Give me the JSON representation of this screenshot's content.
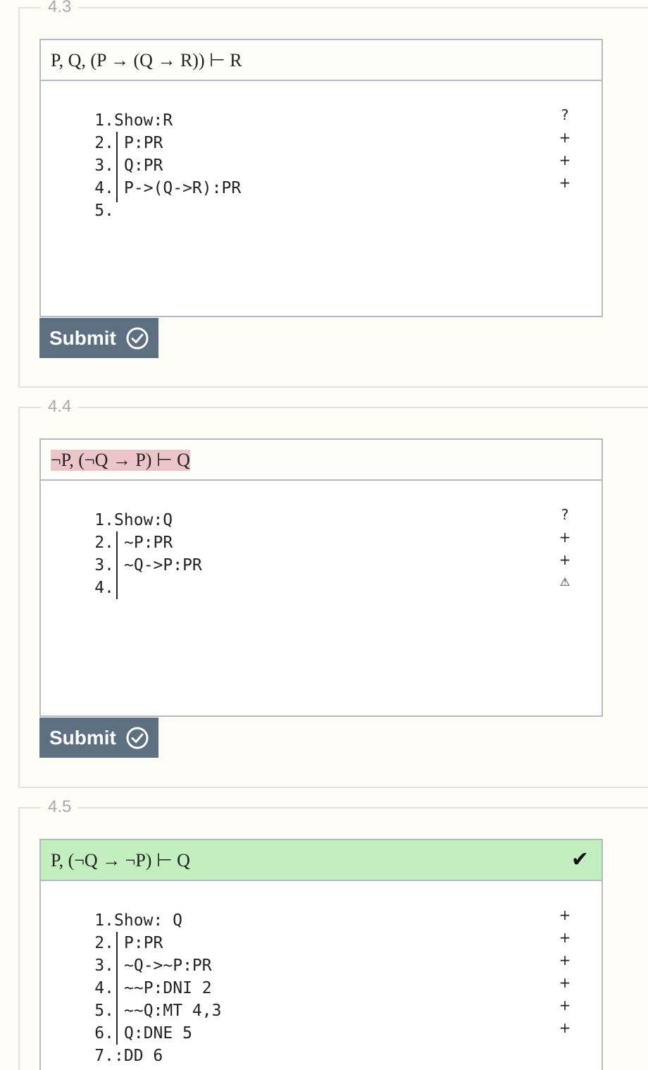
{
  "problems": [
    {
      "number": "4.3",
      "sequent": "P, Q, (P → (Q → R)) ⊢ R",
      "lines": [
        {
          "n": "1.",
          "text": "Show:R"
        },
        {
          "n": "2.",
          "text": "P:PR"
        },
        {
          "n": "3.",
          "text": "Q:PR"
        },
        {
          "n": "4.",
          "text": "P->(Q->R):PR"
        },
        {
          "n": "5.",
          "text": ""
        }
      ],
      "gutter": [
        "?",
        "+",
        "+",
        "+"
      ],
      "submit_label": "Submit"
    },
    {
      "number": "4.4",
      "sequent": "¬P, (¬Q → P) ⊢ Q",
      "lines": [
        {
          "n": "1.",
          "text": "Show:Q"
        },
        {
          "n": "2.",
          "text": "~P:PR"
        },
        {
          "n": "3.",
          "text": "~Q->P:PR"
        },
        {
          "n": "4.",
          "text": ""
        }
      ],
      "gutter": [
        "?",
        "+",
        "+",
        "⚠"
      ],
      "submit_label": "Submit"
    },
    {
      "number": "4.5",
      "sequent": "P, (¬Q → ¬P) ⊢ Q",
      "solved_mark": "✔",
      "lines": [
        {
          "n": "1.",
          "text": "Show: Q"
        },
        {
          "n": "2.",
          "text": "P:PR"
        },
        {
          "n": "3.",
          "text": "~Q->~P:PR"
        },
        {
          "n": "4.",
          "text": "~~P:DNI 2"
        },
        {
          "n": "5.",
          "text": "~~Q:MT 4,3"
        },
        {
          "n": "6.",
          "text": "Q:DNE 5"
        },
        {
          "n": "7.",
          "text": ":DD 6"
        }
      ],
      "gutter": [
        "+",
        "+",
        "+",
        "+",
        "+",
        "+"
      ]
    }
  ],
  "colors": {
    "page_bg": "#fdfdf6",
    "submit_bg": "#5d7081",
    "error_highlight": "#ebc5c8",
    "solved_bg": "#c3efbf",
    "border": "#b3bcc6"
  }
}
